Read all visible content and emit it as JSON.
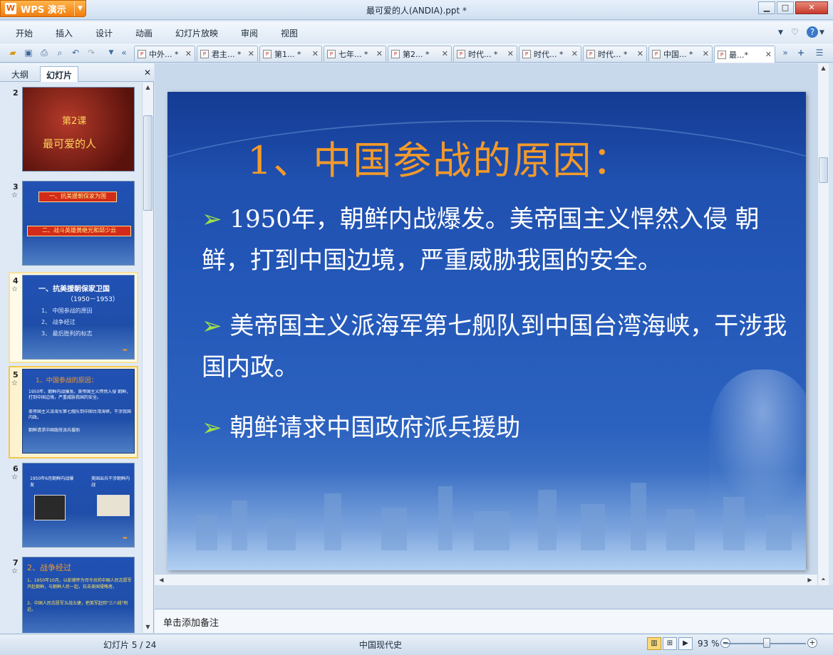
{
  "window": {
    "app_name": "WPS 演示",
    "title": "最可爱的人(ANDIA).ppt *",
    "minimize": "▁",
    "maximize": "□",
    "close": "✕"
  },
  "menu": {
    "items": [
      "开始",
      "插入",
      "设计",
      "动画",
      "幻灯片放映",
      "审阅",
      "视图"
    ],
    "right": [
      "♡",
      "?"
    ]
  },
  "tabs": [
    {
      "label": "中外... *"
    },
    {
      "label": "君主... *"
    },
    {
      "label": "第1... *"
    },
    {
      "label": "七年... *"
    },
    {
      "label": "第2... *"
    },
    {
      "label": "时代... *"
    },
    {
      "label": "时代... *"
    },
    {
      "label": "时代... *"
    },
    {
      "label": "中国... *"
    },
    {
      "label": "最...*",
      "active": true
    }
  ],
  "left_panel": {
    "tabs": [
      "大纲",
      "幻灯片"
    ],
    "active_tab": "幻灯片",
    "close": "✕",
    "slides": [
      {
        "num": "2",
        "star": "",
        "lines": [
          "第2课",
          "最可爱的人"
        ]
      },
      {
        "num": "3",
        "star": "☆",
        "lines": [
          "一、抗美援朝保家为国",
          "二、战斗英雄黄继光和邱少云"
        ]
      },
      {
        "num": "4",
        "star": "☆",
        "lines": [
          "一、抗美援朝保家卫国",
          "（1950－1953）",
          "1、 中国参战的原因",
          "2、 战争经过",
          "3、 最后胜利的标志"
        ]
      },
      {
        "num": "5",
        "star": "☆",
        "lines": [
          "1、中国参战的原因：",
          "1950年，朝鲜内战爆发。美帝国主义悍然入侵 朝鲜，打到中国边境，严重威胁我国的安全。",
          "美帝国主义派海军第七舰队到中国台湾海峡，干涉我国内政。",
          "朝鲜请求中国政府派兵援助"
        ]
      },
      {
        "num": "6",
        "star": "☆",
        "lines": [
          "1950年6月朝鲜内战爆发",
          "美国出兵干涉朝鲜内战"
        ]
      },
      {
        "num": "7",
        "star": "☆",
        "lines": [
          "2、战争经过",
          "1、1950年10月，以彭德怀为司令员的中国人民志愿军开赴朝鲜，与朝鲜人民一起，抗击美国侵略者。",
          "2、中国人民志愿军五战五捷，把美军赶回\"三八线\"附近。"
        ]
      }
    ]
  },
  "slide": {
    "title": "1、中国参战的原因：",
    "bullets": [
      "1950年，朝鲜内战爆发。美帝国主义悍然入侵 朝鲜，打到中国边境，严重威胁我国的安全。",
      "美帝国主义派海军第七舰队到中国台湾海峡，干涉我国内政。",
      "朝鲜请求中国政府派兵援助"
    ],
    "bullet_marker": "➢",
    "colors": {
      "title": "#f39a2a",
      "bullet_marker": "#9fe04a",
      "background": "#2357b8"
    }
  },
  "notes": {
    "placeholder": "单击添加备注"
  },
  "status": {
    "slide_info": "幻灯片 5 / 24",
    "theme": "中国现代史",
    "zoom": "93 %",
    "zoom_minus": "−",
    "zoom_plus": "+"
  }
}
